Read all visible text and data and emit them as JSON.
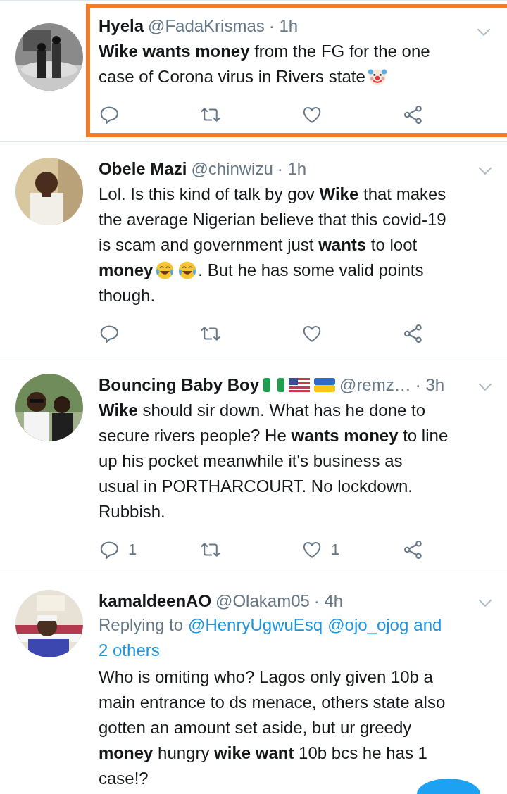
{
  "tweets": [
    {
      "name": "Hyela",
      "handle": "@FadaKrismas",
      "time": "· 1h",
      "highlighted": true,
      "lines": [
        [
          {
            "kind": "text",
            "text": "**Wike wants money** from the FG for the one"
          }
        ],
        [
          {
            "kind": "text",
            "text": "case of Corona virus in Rivers state"
          },
          {
            "kind": "clown"
          }
        ]
      ]
    },
    {
      "name": "Obele Mazi",
      "handle": "@chinwizu",
      "time": "· 1h",
      "highlighted": false,
      "lines": [
        [
          {
            "kind": "text",
            "text": "Lol. Is this kind of talk by gov **Wike** that makes"
          }
        ],
        [
          {
            "kind": "text",
            "text": "the average Nigerian believe that this covid-19"
          }
        ],
        [
          {
            "kind": "text",
            "text": "is scam and government just **wants** to loot"
          }
        ],
        [
          {
            "kind": "text",
            "text": "**money**"
          },
          {
            "kind": "laugh"
          },
          {
            "kind": "laugh"
          },
          {
            "kind": "text",
            "text": ". But he has some valid points"
          }
        ],
        [
          {
            "kind": "text",
            "text": "though."
          }
        ]
      ]
    },
    {
      "name": "Bouncing Baby Boy",
      "flags": true,
      "handle": "@remz…",
      "time": "· 3h",
      "highlighted": false,
      "lines": [
        [
          {
            "kind": "text",
            "text": "**Wike** should sir down. What has he done to"
          }
        ],
        [
          {
            "kind": "text",
            "text": "secure rivers people? He **wants money** to line"
          }
        ],
        [
          {
            "kind": "text",
            "text": "up his pocket meanwhile it's business as"
          }
        ],
        [
          {
            "kind": "text",
            "text": "usual in PORTHARCOURT. No lockdown."
          }
        ],
        [
          {
            "kind": "text",
            "text": "Rubbish."
          }
        ]
      ],
      "replies": "1",
      "likes": "1"
    },
    {
      "name": "kamaldeenAO",
      "handle": "@Olakam05",
      "time": "· 4h",
      "highlighted": false,
      "reply_prefix": "Replying to",
      "mentions": [
        "@HenryUgwuEsq",
        "@ojo_ojog"
      ],
      "reply_joiner": "and",
      "reply_others": "2 others",
      "lines": [
        [
          {
            "kind": "text",
            "text": "Who is omiting who? Lagos only given 10b a"
          }
        ],
        [
          {
            "kind": "text",
            "text": "main entrance to ds menace, others state also"
          }
        ],
        [
          {
            "kind": "text",
            "text": "gotten an amount set aside, but ur greedy"
          }
        ],
        [
          {
            "kind": "text",
            "text": "**money** hungry **wike want** 10b bcs he has 1"
          }
        ],
        [
          {
            "kind": "text",
            "text": "case!?"
          }
        ]
      ]
    }
  ]
}
